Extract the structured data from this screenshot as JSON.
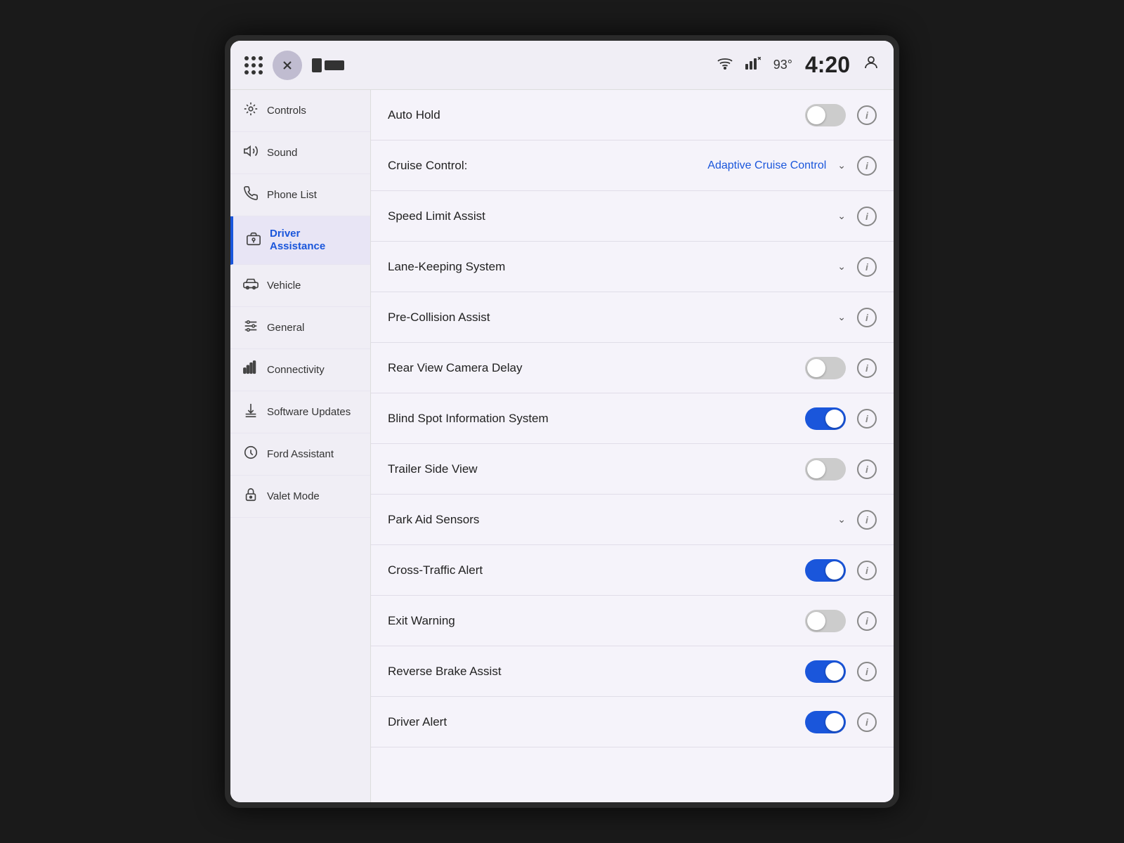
{
  "header": {
    "temperature": "93°",
    "time": "4:20",
    "close_label": "×"
  },
  "sidebar": {
    "items": [
      {
        "id": "controls",
        "label": "Controls",
        "icon": "controls"
      },
      {
        "id": "sound",
        "label": "Sound",
        "icon": "sound"
      },
      {
        "id": "phone-list",
        "label": "Phone List",
        "icon": "phone"
      },
      {
        "id": "driver-assistance",
        "label": "Driver Assistance",
        "icon": "driver-assistance",
        "active": true
      },
      {
        "id": "vehicle",
        "label": "Vehicle",
        "icon": "vehicle"
      },
      {
        "id": "general",
        "label": "General",
        "icon": "general"
      },
      {
        "id": "connectivity",
        "label": "Connectivity",
        "icon": "connectivity"
      },
      {
        "id": "software-updates",
        "label": "Software Updates",
        "icon": "software"
      },
      {
        "id": "ford-assistant",
        "label": "Ford Assistant",
        "icon": "ford-assistant"
      },
      {
        "id": "valet-mode",
        "label": "Valet Mode",
        "icon": "valet"
      }
    ]
  },
  "settings": {
    "title": "Driver Assistance",
    "rows": [
      {
        "id": "auto-hold",
        "label": "Auto Hold",
        "type": "toggle",
        "state": "off"
      },
      {
        "id": "cruise-control",
        "label": "Cruise Control:",
        "type": "dropdown",
        "value": "Adaptive Cruise Control"
      },
      {
        "id": "speed-limit-assist",
        "label": "Speed Limit Assist",
        "type": "dropdown",
        "value": ""
      },
      {
        "id": "lane-keeping",
        "label": "Lane-Keeping System",
        "type": "dropdown",
        "value": ""
      },
      {
        "id": "pre-collision",
        "label": "Pre-Collision Assist",
        "type": "dropdown",
        "value": ""
      },
      {
        "id": "rear-view-camera",
        "label": "Rear View Camera Delay",
        "type": "toggle",
        "state": "off"
      },
      {
        "id": "blind-spot",
        "label": "Blind Spot Information System",
        "type": "toggle",
        "state": "on"
      },
      {
        "id": "trailer-side-view",
        "label": "Trailer Side View",
        "type": "toggle",
        "state": "off"
      },
      {
        "id": "park-aid",
        "label": "Park Aid Sensors",
        "type": "dropdown",
        "value": ""
      },
      {
        "id": "cross-traffic",
        "label": "Cross-Traffic Alert",
        "type": "toggle",
        "state": "on"
      },
      {
        "id": "exit-warning",
        "label": "Exit Warning",
        "type": "toggle",
        "state": "off"
      },
      {
        "id": "reverse-brake",
        "label": "Reverse Brake Assist",
        "type": "toggle",
        "state": "on"
      },
      {
        "id": "driver-alert",
        "label": "Driver Alert",
        "type": "toggle",
        "state": "on"
      }
    ]
  }
}
